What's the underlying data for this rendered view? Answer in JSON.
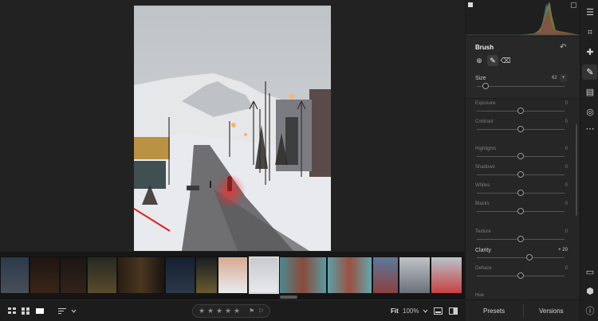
{
  "brush_panel": {
    "title": "Brush",
    "size_label": "Size",
    "size_value": "62",
    "size_more": "+",
    "size_fraction": 0.1
  },
  "sliders": [
    {
      "label": "Exposure",
      "value": "0",
      "position": 0.5,
      "active": false
    },
    {
      "label": "Contrast",
      "value": "0",
      "position": 0.5,
      "active": false
    },
    {
      "label": "Highlights",
      "value": "0",
      "position": 0.5,
      "active": false
    },
    {
      "label": "Shadows",
      "value": "0",
      "position": 0.5,
      "active": false
    },
    {
      "label": "Whites",
      "value": "0",
      "position": 0.5,
      "active": false
    },
    {
      "label": "Blacks",
      "value": "0",
      "position": 0.5,
      "active": false
    },
    {
      "label": "Texture",
      "value": "0",
      "position": 0.5,
      "active": false
    },
    {
      "label": "Clarity",
      "value": "+ 20",
      "position": 0.6,
      "active": true
    },
    {
      "label": "Dehaze",
      "value": "0",
      "position": 0.5,
      "active": false
    },
    {
      "label": "Hue",
      "value": "",
      "position": 0.5,
      "active": false
    }
  ],
  "footer": {
    "presets_label": "Presets",
    "versions_label": "Versions"
  },
  "toolbar": {
    "fit_label": "Fit",
    "zoom_label": "100%",
    "stars": [
      "★",
      "★",
      "★",
      "★",
      "★"
    ]
  },
  "icons": {
    "rail": [
      "sliders-icon",
      "crop-icon",
      "healing-icon",
      "brush-icon",
      "linear-gradient-icon",
      "radial-gradient-icon",
      "more-icon",
      "comment-icon",
      "tag-icon",
      "info-icon"
    ]
  },
  "colors": {
    "accent": "#ffffff",
    "panel_bg": "#262626",
    "app_bg": "#1e1e1e"
  }
}
